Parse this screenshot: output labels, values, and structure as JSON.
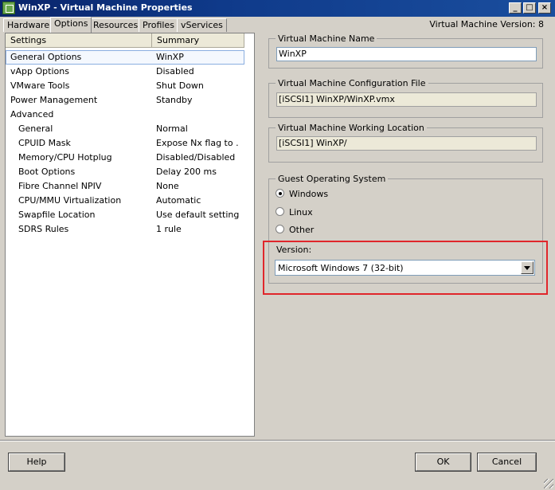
{
  "window": {
    "title": "WinXP - Virtual Machine Properties"
  },
  "tabs": [
    {
      "label": "Hardware"
    },
    {
      "label": "Options"
    },
    {
      "label": "Resources"
    },
    {
      "label": "Profiles"
    },
    {
      "label": "vServices"
    }
  ],
  "header": {
    "version_label": "Virtual Machine Version: 8"
  },
  "options_list": {
    "columns": [
      "Settings",
      "Summary"
    ],
    "rows": [
      {
        "setting": "General Options",
        "summary": "WinXP"
      },
      {
        "setting": "vApp Options",
        "summary": "Disabled"
      },
      {
        "setting": "VMware Tools",
        "summary": "Shut Down"
      },
      {
        "setting": "Power Management",
        "summary": "Standby"
      },
      {
        "setting": "Advanced",
        "summary": ""
      },
      {
        "setting": "General",
        "summary": "Normal"
      },
      {
        "setting": "CPUID Mask",
        "summary": "Expose Nx flag to ..."
      },
      {
        "setting": "Memory/CPU Hotplug",
        "summary": "Disabled/Disabled"
      },
      {
        "setting": "Boot Options",
        "summary": "Delay 200 ms"
      },
      {
        "setting": "Fibre Channel NPIV",
        "summary": "None"
      },
      {
        "setting": "CPU/MMU Virtualization",
        "summary": "Automatic"
      },
      {
        "setting": "Swapfile Location",
        "summary": "Use default settings"
      },
      {
        "setting": "SDRS Rules",
        "summary": "1 rule"
      }
    ]
  },
  "vm_name": {
    "label": "Virtual Machine Name",
    "value": "WinXP"
  },
  "config_file": {
    "label": "Virtual Machine Configuration File",
    "value": "[iSCSI1] WinXP/WinXP.vmx"
  },
  "working_location": {
    "label": "Virtual Machine Working Location",
    "value": "[iSCSI1] WinXP/"
  },
  "guest_os": {
    "label": "Guest Operating System",
    "options": [
      {
        "label": "Windows",
        "selected": true
      },
      {
        "label": "Linux",
        "selected": false
      },
      {
        "label": "Other",
        "selected": false
      }
    ],
    "version_label": "Version:",
    "version_value": "Microsoft Windows 7 (32-bit)"
  },
  "buttons": {
    "help": "Help",
    "ok": "OK",
    "cancel": "Cancel"
  },
  "colors": {
    "title_bar": "#0a246a",
    "highlight_box": "#e0262b",
    "background": "#d4d0c8"
  }
}
